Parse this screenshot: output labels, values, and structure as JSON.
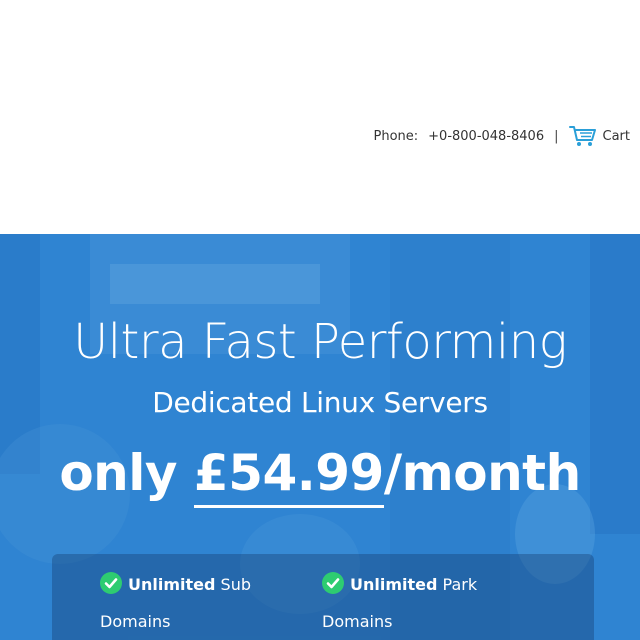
{
  "header": {
    "phone_label": "Phone:",
    "phone_number": "+0-800-048-8406",
    "separator": "|",
    "cart_label": "Cart",
    "cart_icon": "cart-icon"
  },
  "hero": {
    "title": "Ultra Fast Performing",
    "subtitle": "Dedicated Linux Servers",
    "price_prefix": "only ",
    "price_amount": "£54.99",
    "price_suffix": "/month"
  },
  "features": [
    {
      "bold": "Unlimited",
      "rest": " Sub",
      "line2": "Domains",
      "icon": "check-circle-icon"
    },
    {
      "bold": "Unlimited",
      "rest": " Park",
      "line2": "Domains",
      "icon": "check-circle-icon"
    }
  ],
  "colors": {
    "hero_blue": "#2f86d4",
    "check_green": "#2ecc71",
    "cart_blue": "#2a9fd8"
  }
}
